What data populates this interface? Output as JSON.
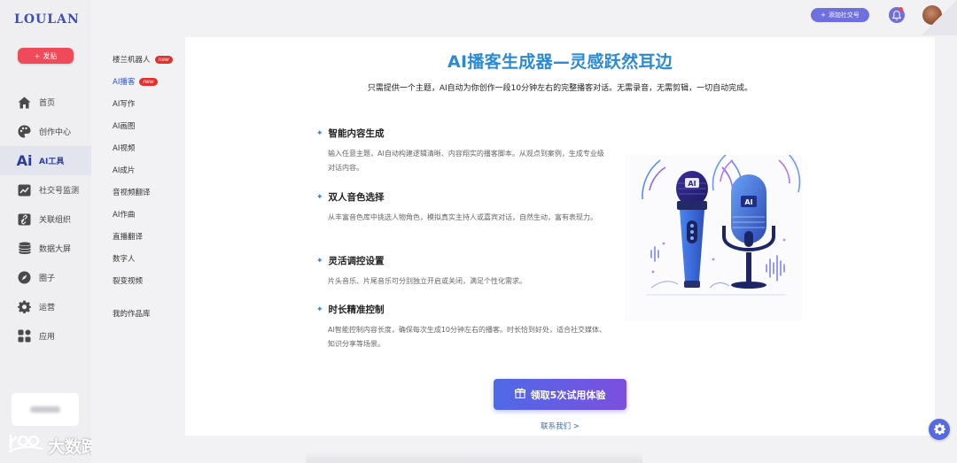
{
  "app": {
    "logo": "LOULAN",
    "publish_label": "发贴"
  },
  "nav": [
    {
      "label": "首页",
      "icon": "home-icon"
    },
    {
      "label": "创作中心",
      "icon": "palette-icon"
    },
    {
      "label": "AI工具",
      "icon": "ai-icon",
      "glyph": "Ai",
      "active": true
    },
    {
      "label": "社交号监测",
      "icon": "chart-icon"
    },
    {
      "label": "关联组织",
      "icon": "link-icon"
    },
    {
      "label": "数据大屏",
      "icon": "database-icon"
    },
    {
      "label": "圈子",
      "icon": "compass-icon"
    },
    {
      "label": "运营",
      "icon": "gear-icon"
    },
    {
      "label": "应用",
      "icon": "apps-icon"
    }
  ],
  "submenu": [
    {
      "label": "楼兰机器人",
      "badge": "new"
    },
    {
      "label": "AI播客",
      "badge": "new",
      "active": true
    },
    {
      "label": "AI写作"
    },
    {
      "label": "AI画图"
    },
    {
      "label": "AI视频"
    },
    {
      "label": "AI成片"
    },
    {
      "label": "音视频翻译"
    },
    {
      "label": "AI作曲"
    },
    {
      "label": "直播翻译"
    },
    {
      "label": "数字人"
    },
    {
      "label": "裂变视频"
    },
    {
      "label": "我的作品库"
    }
  ],
  "topbar": {
    "add_social_label": "添加社交号"
  },
  "main": {
    "title": "AI播客生成器—灵感跃然耳边",
    "subtitle": "只需提供一个主题，AI自动为你创作一段10分钟左右的完整播客对话。无需录音，无需剪辑，一切自动完成。",
    "features": [
      {
        "title": "智能内容生成",
        "desc": "输入任意主题，AI自动构建逻辑清晰、内容翔实的播客脚本。从观点到案例，生成专业级对话内容。"
      },
      {
        "title": "双人音色选择",
        "desc": "从丰富音色库中挑选人物角色，模拟真实主持人或嘉宾对话，自然生动，富有表现力。"
      },
      {
        "title": "灵活调控设置",
        "desc": "片头音乐、片尾音乐可分别独立开启或关闭，满足个性化需求。"
      },
      {
        "title": "时长精准控制",
        "desc": "AI智能控制内容长度，确保每次生成10分钟左右的播客。时长恰到好处，适合社交媒体、知识分享等场景。"
      }
    ],
    "mic_labels": [
      "AI",
      "AI"
    ],
    "cta_label": "领取5次试用体验",
    "contact_label": "联系我们 >"
  },
  "watermark": {
    "text": "大数跨境"
  },
  "colors": {
    "accent": "#2a8ad6",
    "primary": "#5569e0",
    "publish": "#ef4a5a"
  }
}
